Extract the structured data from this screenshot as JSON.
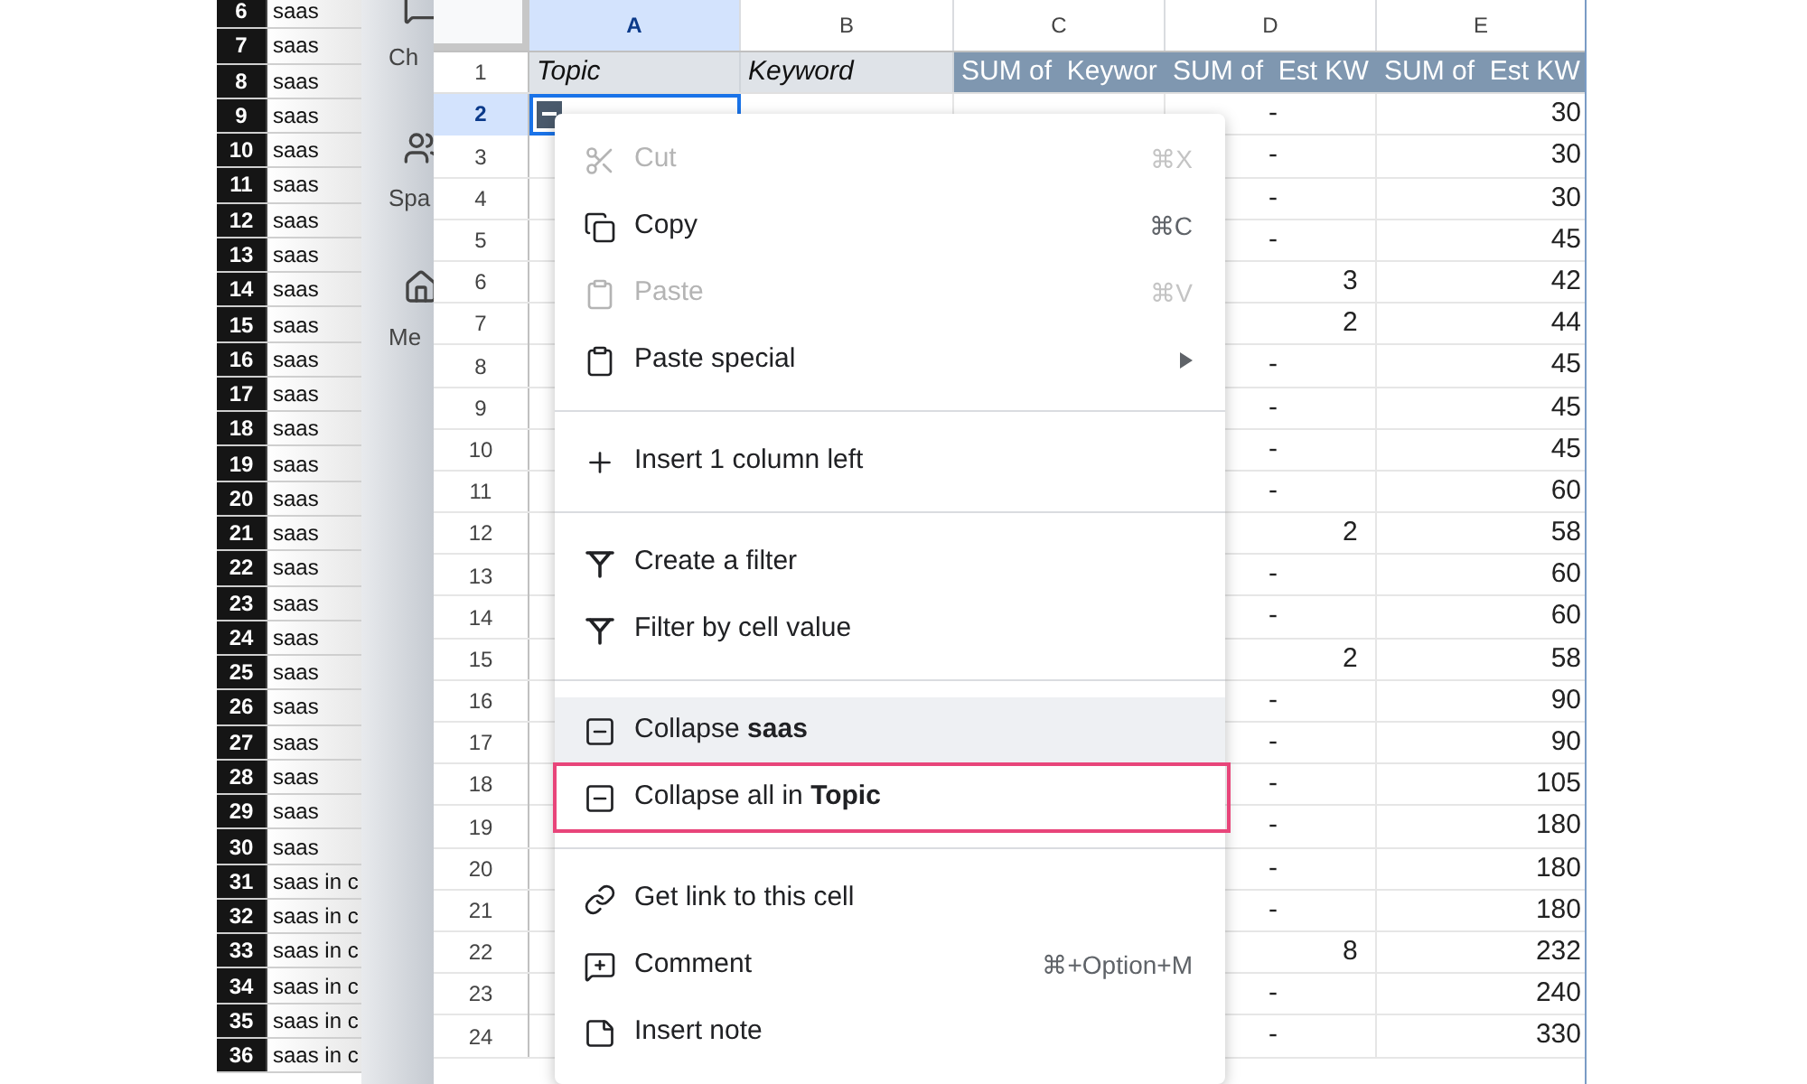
{
  "back_sheet": {
    "rows": [
      {
        "number": "6",
        "value": "saas"
      },
      {
        "number": "7",
        "value": "saas"
      },
      {
        "number": "8",
        "value": "saas"
      },
      {
        "number": "9",
        "value": "saas"
      },
      {
        "number": "10",
        "value": "saas"
      },
      {
        "number": "11",
        "value": "saas"
      },
      {
        "number": "12",
        "value": "saas"
      },
      {
        "number": "13",
        "value": "saas"
      },
      {
        "number": "14",
        "value": "saas"
      },
      {
        "number": "15",
        "value": "saas"
      },
      {
        "number": "16",
        "value": "saas"
      },
      {
        "number": "17",
        "value": "saas"
      },
      {
        "number": "18",
        "value": "saas"
      },
      {
        "number": "19",
        "value": "saas"
      },
      {
        "number": "20",
        "value": "saas"
      },
      {
        "number": "21",
        "value": "saas"
      },
      {
        "number": "22",
        "value": "saas"
      },
      {
        "number": "23",
        "value": "saas"
      },
      {
        "number": "24",
        "value": "saas"
      },
      {
        "number": "25",
        "value": "saas"
      },
      {
        "number": "26",
        "value": "saas"
      },
      {
        "number": "27",
        "value": "saas"
      },
      {
        "number": "28",
        "value": "saas"
      },
      {
        "number": "29",
        "value": "saas"
      },
      {
        "number": "30",
        "value": "saas"
      },
      {
        "number": "31",
        "value": "saas in c"
      },
      {
        "number": "32",
        "value": "saas in c"
      },
      {
        "number": "33",
        "value": "saas in c"
      },
      {
        "number": "34",
        "value": "saas in c"
      },
      {
        "number": "35",
        "value": "saas in c"
      },
      {
        "number": "36",
        "value": "saas in c"
      }
    ]
  },
  "sidebar": {
    "items": [
      {
        "label": "Ch",
        "kind": "chat"
      },
      {
        "label": "Spa",
        "kind": "people"
      },
      {
        "label": "Me",
        "kind": "home"
      }
    ]
  },
  "sheet": {
    "columns": [
      {
        "label": "A",
        "selected": true
      },
      {
        "label": "B",
        "selected": false
      },
      {
        "label": "C",
        "selected": false
      },
      {
        "label": "D",
        "selected": false
      },
      {
        "label": "E",
        "selected": false
      }
    ],
    "header_row": {
      "number": "1",
      "cells": [
        {
          "text": "Topic",
          "kind": "field"
        },
        {
          "text": "Keyword",
          "kind": "field"
        },
        {
          "text": "SUM of  Keywor",
          "kind": "sum"
        },
        {
          "text": "SUM of  Est KW",
          "kind": "sum"
        },
        {
          "text": "SUM of  Est KW",
          "kind": "sum"
        }
      ]
    },
    "rows": [
      {
        "number": "2",
        "selected": true,
        "group_toggle": true,
        "d": {
          "text": "-",
          "kind": "dash"
        },
        "e": "30"
      },
      {
        "number": "3",
        "selected": false,
        "group_toggle": false,
        "d": {
          "text": "-",
          "kind": "dash"
        },
        "e": "30"
      },
      {
        "number": "4",
        "selected": false,
        "group_toggle": false,
        "d": {
          "text": "-",
          "kind": "dash"
        },
        "e": "30"
      },
      {
        "number": "5",
        "selected": false,
        "group_toggle": false,
        "d": {
          "text": "-",
          "kind": "dash"
        },
        "e": "45"
      },
      {
        "number": "6",
        "selected": false,
        "group_toggle": false,
        "d": {
          "text": "3",
          "kind": "number"
        },
        "e": "42"
      },
      {
        "number": "7",
        "selected": false,
        "group_toggle": false,
        "d": {
          "text": "2",
          "kind": "number"
        },
        "e": "44"
      },
      {
        "number": "8",
        "selected": false,
        "group_toggle": false,
        "d": {
          "text": "-",
          "kind": "dash"
        },
        "e": "45"
      },
      {
        "number": "9",
        "selected": false,
        "group_toggle": false,
        "d": {
          "text": "-",
          "kind": "dash"
        },
        "e": "45"
      },
      {
        "number": "10",
        "selected": false,
        "group_toggle": false,
        "d": {
          "text": "-",
          "kind": "dash"
        },
        "e": "45"
      },
      {
        "number": "11",
        "selected": false,
        "group_toggle": false,
        "d": {
          "text": "-",
          "kind": "dash"
        },
        "e": "60"
      },
      {
        "number": "12",
        "selected": false,
        "group_toggle": false,
        "d": {
          "text": "2",
          "kind": "number"
        },
        "e": "58"
      },
      {
        "number": "13",
        "selected": false,
        "group_toggle": false,
        "d": {
          "text": "-",
          "kind": "dash"
        },
        "e": "60"
      },
      {
        "number": "14",
        "selected": false,
        "group_toggle": false,
        "d": {
          "text": "-",
          "kind": "dash"
        },
        "e": "60"
      },
      {
        "number": "15",
        "selected": false,
        "group_toggle": false,
        "d": {
          "text": "2",
          "kind": "number"
        },
        "e": "58"
      },
      {
        "number": "16",
        "selected": false,
        "group_toggle": false,
        "d": {
          "text": "-",
          "kind": "dash"
        },
        "e": "90"
      },
      {
        "number": "17",
        "selected": false,
        "group_toggle": false,
        "d": {
          "text": "-",
          "kind": "dash"
        },
        "e": "90"
      },
      {
        "number": "18",
        "selected": false,
        "group_toggle": false,
        "d": {
          "text": "-",
          "kind": "dash"
        },
        "e": "105"
      },
      {
        "number": "19",
        "selected": false,
        "group_toggle": false,
        "d": {
          "text": "-",
          "kind": "dash"
        },
        "e": "180"
      },
      {
        "number": "20",
        "selected": false,
        "group_toggle": false,
        "d": {
          "text": "-",
          "kind": "dash"
        },
        "e": "180"
      },
      {
        "number": "21",
        "selected": false,
        "group_toggle": false,
        "d": {
          "text": "-",
          "kind": "dash"
        },
        "e": "180"
      },
      {
        "number": "22",
        "selected": false,
        "group_toggle": false,
        "d": {
          "text": "8",
          "kind": "number"
        },
        "e": "232"
      },
      {
        "number": "23",
        "selected": false,
        "group_toggle": false,
        "d": {
          "text": "-",
          "kind": "dash"
        },
        "e": "240"
      },
      {
        "number": "24",
        "selected": false,
        "group_toggle": false,
        "d": {
          "text": "-",
          "kind": "dash"
        },
        "e": "330"
      }
    ]
  },
  "context_menu": {
    "groups": [
      [
        {
          "label": "Cut",
          "kind": "scissors",
          "shortcut": "⌘X",
          "disabled": true,
          "hovered": false,
          "highlighted": false,
          "submenu": false
        },
        {
          "label": "Copy",
          "kind": "copy",
          "shortcut": "⌘C",
          "disabled": false,
          "hovered": false,
          "highlighted": false,
          "submenu": false
        },
        {
          "label": "Paste",
          "kind": "clipboard",
          "shortcut": "⌘V",
          "disabled": true,
          "hovered": false,
          "highlighted": false,
          "submenu": false
        },
        {
          "label": "Paste special",
          "kind": "clipboard",
          "disabled": false,
          "hovered": false,
          "highlighted": false,
          "submenu": true
        }
      ],
      [
        {
          "label": "Insert 1 column left",
          "kind": "plus",
          "disabled": false,
          "hovered": false,
          "highlighted": false,
          "submenu": false
        }
      ],
      [
        {
          "label": "Create a filter",
          "kind": "filter",
          "disabled": false,
          "hovered": false,
          "highlighted": false,
          "submenu": false
        },
        {
          "label": "Filter by cell value",
          "kind": "filter",
          "disabled": false,
          "hovered": false,
          "highlighted": false,
          "submenu": false
        }
      ],
      [
        {
          "label": "Collapse **saas**",
          "kind": "collapse",
          "disabled": false,
          "hovered": true,
          "highlighted": false,
          "submenu": false
        },
        {
          "label": "Collapse all in **Topic**",
          "kind": "collapse",
          "disabled": false,
          "hovered": false,
          "highlighted": true,
          "submenu": false
        }
      ],
      [
        {
          "label": "Get link to this cell",
          "kind": "link",
          "disabled": false,
          "hovered": false,
          "highlighted": false,
          "submenu": false
        },
        {
          "label": "Comment",
          "kind": "comment",
          "shortcut": "⌘+Option+M",
          "disabled": false,
          "hovered": false,
          "highlighted": false,
          "submenu": false
        },
        {
          "label": "Insert note",
          "kind": "note",
          "disabled": false,
          "hovered": false,
          "highlighted": false,
          "submenu": false
        }
      ]
    ]
  }
}
